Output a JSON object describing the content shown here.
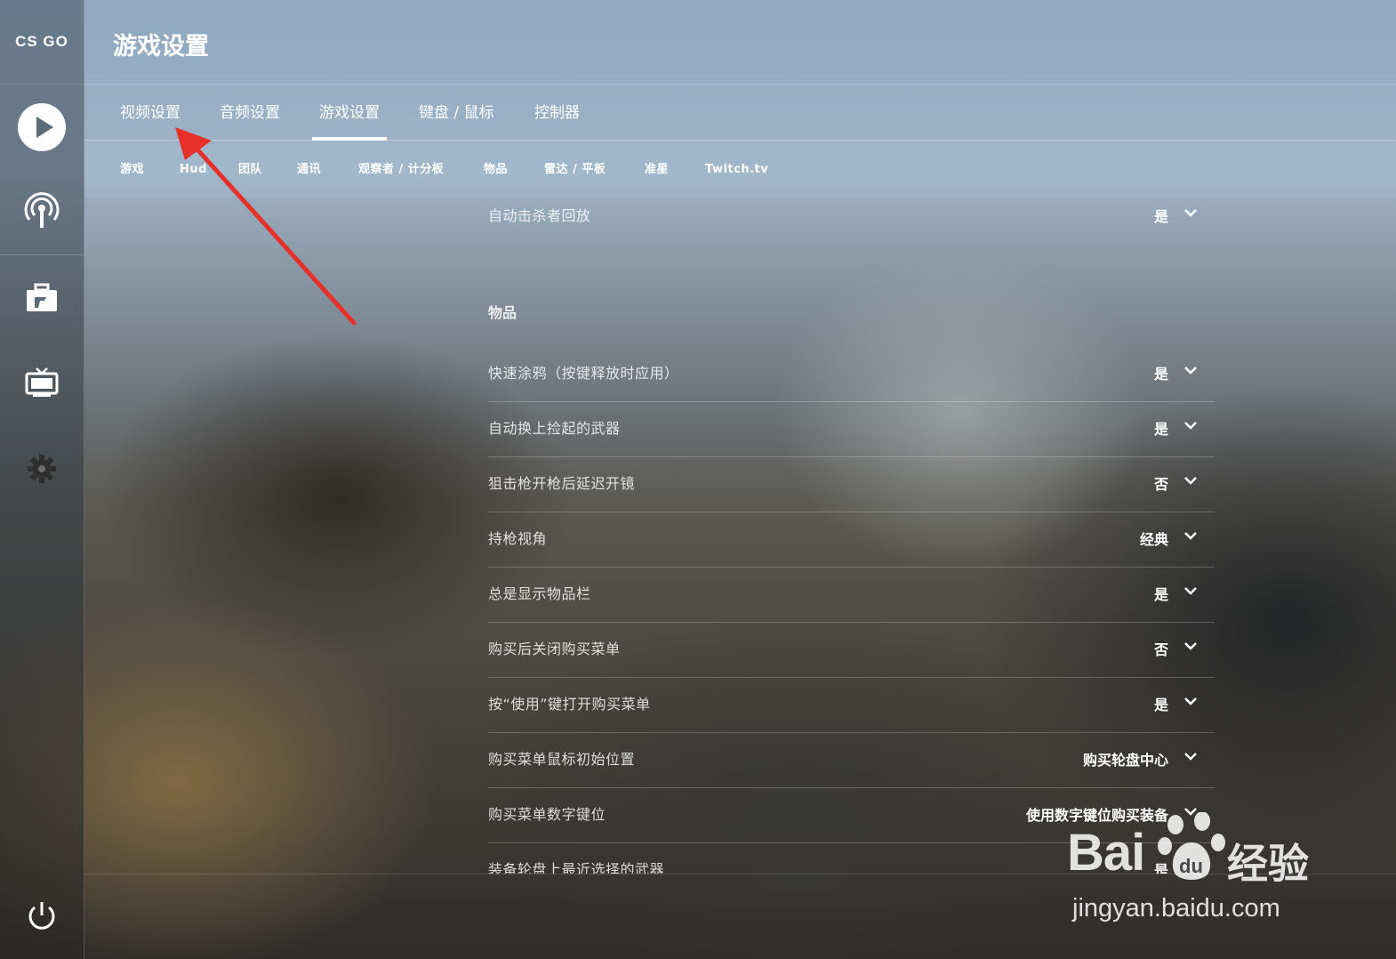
{
  "sidebar": {
    "logo": "CS GO",
    "items": [
      {
        "icon": "play-icon"
      },
      {
        "icon": "broadcast-icon"
      },
      {
        "icon": "briefcase-icon"
      },
      {
        "icon": "tv-icon"
      },
      {
        "icon": "gear-icon"
      },
      {
        "icon": "power-icon"
      }
    ]
  },
  "header": {
    "title": "游戏设置"
  },
  "tabs": [
    {
      "label": "视频设置"
    },
    {
      "label": "音频设置"
    },
    {
      "label": "游戏设置",
      "active": true
    },
    {
      "label": "键盘 / 鼠标"
    },
    {
      "label": "控制器"
    }
  ],
  "subtabs": [
    {
      "label": "游戏"
    },
    {
      "label": "Hud"
    },
    {
      "label": "团队"
    },
    {
      "label": "通讯"
    },
    {
      "label": "观察者 / 计分板"
    },
    {
      "label": "物品"
    },
    {
      "label": "雷达 / 平板"
    },
    {
      "label": "准星"
    },
    {
      "label": "Twitch.tv"
    }
  ],
  "settings": {
    "top_row": {
      "label": "自动击杀者回放",
      "value": "是"
    },
    "section_title": "物品",
    "rows": [
      {
        "label": "快速涂鸦（按键释放时应用）",
        "value": "是"
      },
      {
        "label": "自动换上捡起的武器",
        "value": "是"
      },
      {
        "label": "狙击枪开枪后延迟开镜",
        "value": "否"
      },
      {
        "label": "持枪视角",
        "value": "经典"
      },
      {
        "label": "总是显示物品栏",
        "value": "是"
      },
      {
        "label": "购买后关闭购买菜单",
        "value": "否"
      },
      {
        "label": "按“使用”键打开购买菜单",
        "value": "是"
      },
      {
        "label": "购买菜单鼠标初始位置",
        "value": "购买轮盘中心"
      },
      {
        "label": "购买菜单数字键位",
        "value": "使用数字键位购买装备"
      },
      {
        "label": "装备轮盘上最近选择的武器",
        "value": "是"
      }
    ]
  },
  "watermark": {
    "brand": "Bai",
    "brand2": "经验",
    "url": "jingyan.baidu.com"
  },
  "colors": {
    "annotation_arrow": "#e8302a",
    "text": "#ffffff"
  }
}
